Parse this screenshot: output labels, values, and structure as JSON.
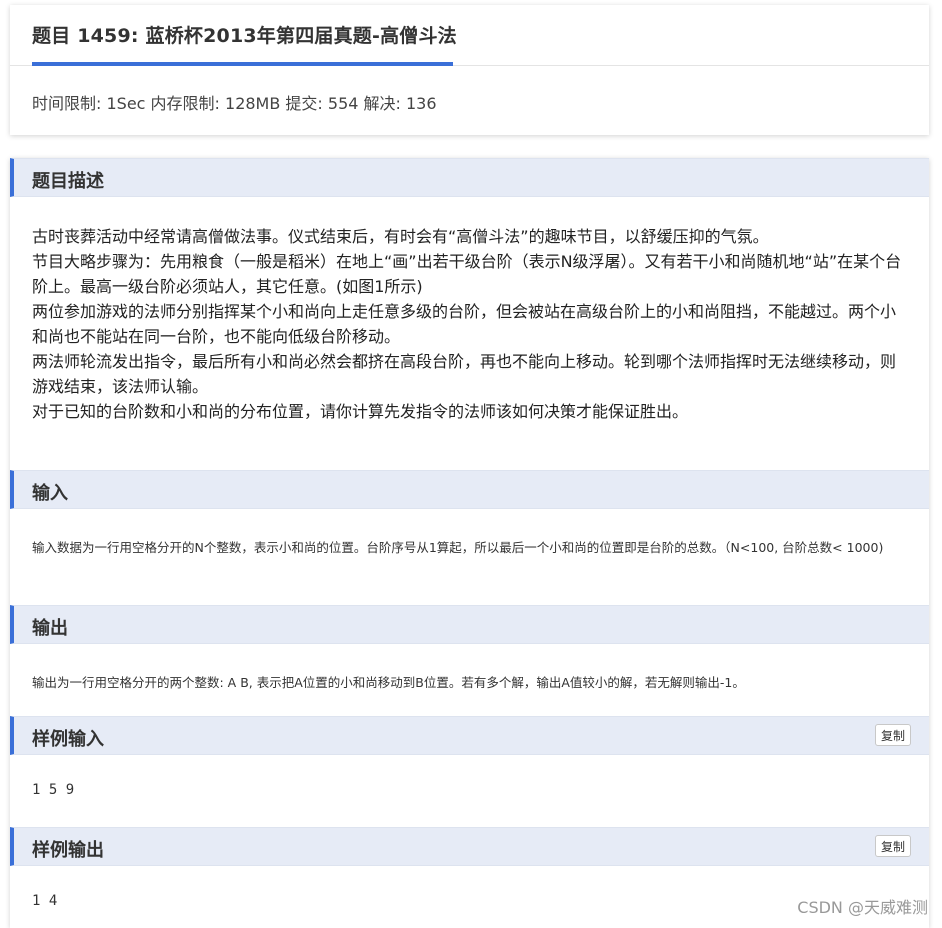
{
  "problem": {
    "title": "题目 1459: 蓝桥杯2013年第四届真题-高僧斗法",
    "limits": "时间限制: 1Sec 内存限制: 128MB 提交: 554 解决: 136"
  },
  "sections": {
    "description": {
      "heading": "题目描述",
      "paragraphs": [
        "古时丧葬活动中经常请高僧做法事。仪式结束后，有时会有“高僧斗法”的趣味节目，以舒缓压抑的气氛。",
        "节目大略步骤为：先用粮食（一般是稻米）在地上“画”出若干级台阶（表示N级浮屠）。又有若干小和尚随机地“站”在某个台阶上。最高一级台阶必须站人，其它任意。(如图1所示)",
        "两位参加游戏的法师分别指挥某个小和尚向上走任意多级的台阶，但会被站在高级台阶上的小和尚阻挡，不能越过。两个小和尚也不能站在同一台阶，也不能向低级台阶移动。",
        "两法师轮流发出指令，最后所有小和尚必然会都挤在高段台阶，再也不能向上移动。轮到哪个法师指挥时无法继续移动，则游戏结束，该法师认输。",
        "对于已知的台阶数和小和尚的分布位置，请你计算先发指令的法师该如何决策才能保证胜出。"
      ]
    },
    "input": {
      "heading": "输入",
      "text": "输入数据为一行用空格分开的N个整数，表示小和尚的位置。台阶序号从1算起，所以最后一个小和尚的位置即是台阶的总数。（N<100, 台阶总数< 1000)"
    },
    "output": {
      "heading": "输出",
      "text": "输出为一行用空格分开的两个整数: A B, 表示把A位置的小和尚移动到B位置。若有多个解，输出A值较小的解，若无解则输出-1。"
    },
    "sample_input": {
      "heading": "样例输入",
      "copy_label": "复制",
      "content": "1 5 9"
    },
    "sample_output": {
      "heading": "样例输出",
      "copy_label": "复制",
      "content": "1 4"
    }
  },
  "watermark": "CSDN @天威难测",
  "colors": {
    "accent": "#3a6fd8",
    "section_bg": "#e6ebf6"
  }
}
